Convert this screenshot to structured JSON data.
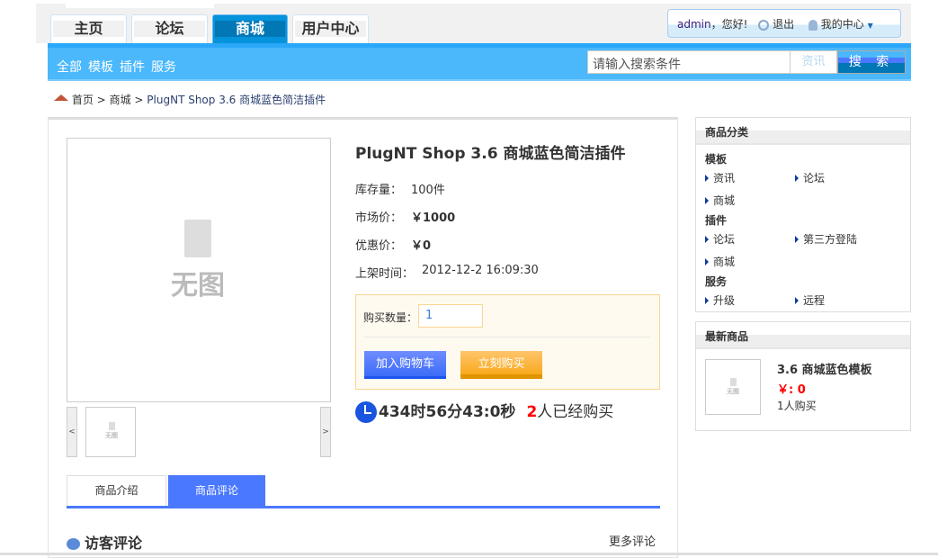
{
  "header": {
    "tabs": [
      {
        "label": "主页"
      },
      {
        "label": "论坛"
      },
      {
        "label": "商城"
      },
      {
        "label": "用户中心"
      }
    ],
    "user": {
      "name": "admin",
      "greeting": "，您好!",
      "logout": "退出",
      "center": "我的中心"
    }
  },
  "nav": {
    "links": [
      "全部",
      "模板",
      "插件",
      "服务"
    ],
    "search_placeholder": "请输入搜索条件",
    "search_category": "资讯",
    "search_button": "搜 索"
  },
  "breadcrumb": {
    "home": "首页",
    "sep": ">",
    "shop": "商城",
    "current": "PlugNT Shop 3.6 商城蓝色简洁插件"
  },
  "product": {
    "title": "PlugNT Shop 3.6 商城蓝色简洁插件",
    "no_image": "无图",
    "stock_label": "库存量：",
    "stock": "100件",
    "market_label": "市场价：",
    "market_price": "￥1000",
    "sale_label": "优惠价：",
    "sale_price": "￥0",
    "time_label": "上架时间：",
    "time": "2012-12-2 16:09:30",
    "qty_label": "购买数量：",
    "qty": "1",
    "add_cart": "加入购物车",
    "buy_now": "立刻购买",
    "countdown": "434时56分43:0秒",
    "buyers_count": "2",
    "buyers_text": "人已经购买",
    "prev": "<",
    "next": ">"
  },
  "tabs": [
    {
      "label": "商品介绍"
    },
    {
      "label": "商品评论"
    }
  ],
  "comments": {
    "title": "访客评论",
    "more": "更多评论"
  },
  "sidebar": {
    "categories_title": "商品分类",
    "groups": [
      {
        "name": "模板",
        "items": [
          "资讯",
          "论坛",
          "商城"
        ]
      },
      {
        "name": "插件",
        "items": [
          "论坛",
          "第三方登陆",
          "商城"
        ]
      },
      {
        "name": "服务",
        "items": [
          "升级",
          "远程"
        ]
      }
    ],
    "latest_title": "最新商品",
    "latest": {
      "name": "3.6 商城蓝色模板",
      "price": "￥: 0",
      "buyers": "1人购买",
      "no_image": "无图"
    }
  },
  "colors": {
    "nav": "#4bb8fc",
    "accent": "#4a78ff",
    "price_red": "#ff0000"
  }
}
